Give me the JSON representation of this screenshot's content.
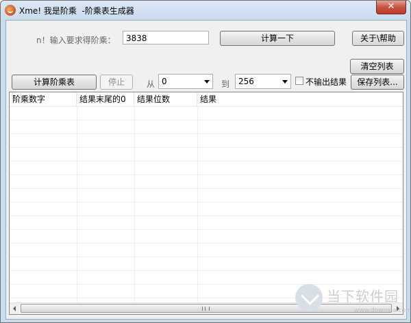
{
  "window": {
    "title": "Xme! 我是阶乘  -阶乘表生成器",
    "close_label": "✕"
  },
  "top": {
    "n_label": "n！输入要求得阶乘：",
    "n_value": "3838",
    "compute_button": "计算一下",
    "about_button": "关于\\帮助",
    "clear_button": "清空列表"
  },
  "toolbar": {
    "calc_table_button": "计算阶乘表",
    "stop_button": "停止",
    "from_label": "从",
    "from_value": "0",
    "to_label": "到",
    "to_value": "256",
    "no_output_label": "不输出结果",
    "save_button": "保存列表..."
  },
  "table": {
    "columns": [
      "阶乘数字",
      "结果末尾的0",
      "结果位数",
      "结果"
    ]
  },
  "watermark": {
    "title": "当下软件园",
    "url": "www.downxia.com"
  },
  "icons": [
    "app-logo-icon",
    "close-icon",
    "dropdown-arrow-icon",
    "scroll-left-icon",
    "scroll-right-icon",
    "download-icon"
  ]
}
